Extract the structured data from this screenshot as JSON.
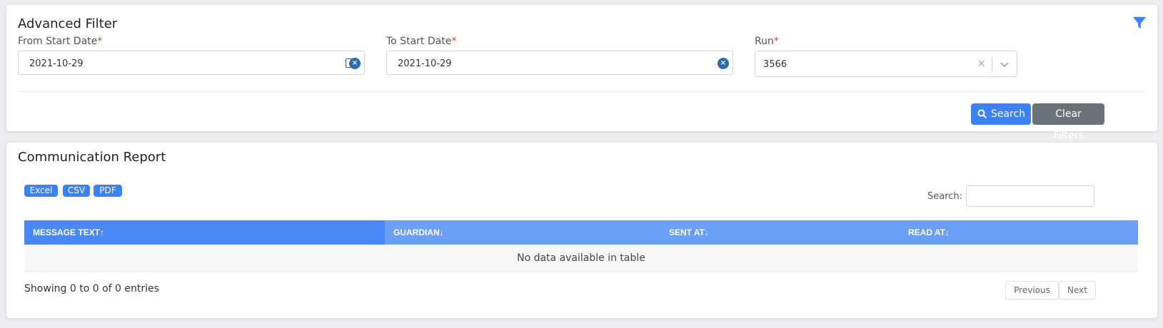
{
  "filter": {
    "title": "Advanced Filter",
    "from_label": "From Start Date",
    "to_label": "To Start Date",
    "run_label": "Run",
    "required_mark": "*",
    "from_value": "2021-10-29",
    "to_value": "2021-10-29",
    "run_value": "3566",
    "search_label": "Search",
    "clear_label": "Clear Filters",
    "icons": [
      "filter-icon",
      "calendar-icon",
      "clear-icon",
      "chevron-down-icon",
      "search-icon"
    ],
    "accent": "#3b82f6"
  },
  "report": {
    "title": "Communication Report",
    "export_buttons": [
      "Excel",
      "CSV",
      "PDF"
    ],
    "search_label": "Search:",
    "columns": [
      "MESSAGE TEXT",
      "GUARDIAN",
      "SENT AT",
      "READ AT"
    ],
    "sort_arrows": [
      "↑",
      "↓",
      "↓",
      "↓"
    ],
    "empty_text": "No data available in table",
    "info": "Showing 0 to 0 of 0 entries",
    "prev_label": "Previous",
    "next_label": "Next"
  }
}
